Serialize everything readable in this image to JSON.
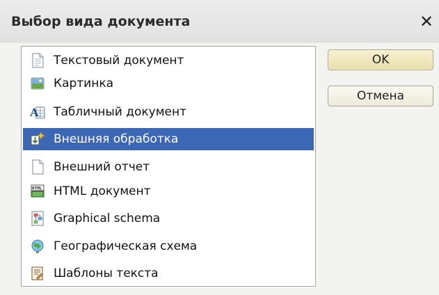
{
  "window": {
    "title": "Выбор вида документа",
    "close_symbol": "✕"
  },
  "list": {
    "selected_index": 3,
    "items": [
      {
        "label": "Текстовый документ",
        "icon": "text-document-icon"
      },
      {
        "label": "Картинка",
        "icon": "picture-icon"
      },
      {
        "label": "Табличный документ",
        "icon": "spreadsheet-document-icon"
      },
      {
        "label": "Внешняя обработка",
        "icon": "external-processing-icon"
      },
      {
        "label": "Внешний отчет",
        "icon": "external-report-icon"
      },
      {
        "label": "HTML документ",
        "icon": "html-document-icon"
      },
      {
        "label": "Graphical schema",
        "icon": "graphical-schema-icon"
      },
      {
        "label": "Географическая схема",
        "icon": "geographic-schema-icon"
      },
      {
        "label": "Шаблоны текста",
        "icon": "text-templates-icon"
      }
    ]
  },
  "buttons": {
    "ok_label": "OK",
    "cancel_label": "Отмена"
  },
  "colors": {
    "selection": "#3c67b5",
    "ok_button": "#efe6bc",
    "title_bar": "#e6e6e6"
  }
}
